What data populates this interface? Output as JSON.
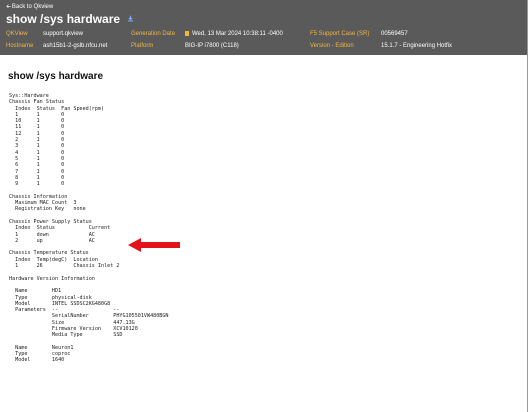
{
  "header": {
    "back_label": "Back to Qkview",
    "title": "show /sys hardware",
    "row1": {
      "qkview_label": "QKView",
      "qkview_value": "support.qkview",
      "gendate_label": "Generation Date",
      "gendate_value": "Wed, 13 Mar 2024 10:38:11 -0400",
      "case_label": "F5 Support Case (SR)",
      "case_value": "00569457"
    },
    "row2": {
      "hostname_label": "Hostname",
      "hostname_value": "ash15b1-2-gslb.nfcu.net",
      "platform_label": "Platform",
      "platform_value": "BIG-IP i7800 (C118)",
      "version_label": "Version - Edition",
      "version_value": "15.1.7 - Engineering Hotfix"
    }
  },
  "content": {
    "section_title": "show /sys hardware",
    "output": "Sys::Hardware\nChassis Fan Status\n  Index  Status  Fan Speed(rpm)\n  1      1       0\n  10     1       0\n  11     1       0\n  12     1       0\n  2      1       0\n  3      1       0\n  4      1       0\n  5      1       0\n  6      1       0\n  7      1       0\n  8      1       0\n  9      1       0\n\nChassis Information\n  Maximum MAC Count  3\n  Registration Key   none\n\nChassis Power Supply Status\n  Index  Status           Current\n  1      down             AC\n  2      up               AC\n\nChassis Temperature Status\n  Index  Temp(degC)  Location\n  1      26          Chassis Inlet 2\n\nHardware Version Information\n\n  Name        HD1\n  Type        physical-disk\n  Model       INTEL SSDSC2KG480G8\n  Parameters  --                  --\n              SerialNumber        PHYG105501VW480BGN\n              Size                447.13G\n              Firmware Version    XCV10120\n              Media Type          SSD\n\n  Name        Neuron1\n  Type        coproc\n  Model       1640"
  },
  "colors": {
    "header_bg": "#5a5a5a",
    "label": "#f2b640",
    "arrow": "#e3121b"
  }
}
